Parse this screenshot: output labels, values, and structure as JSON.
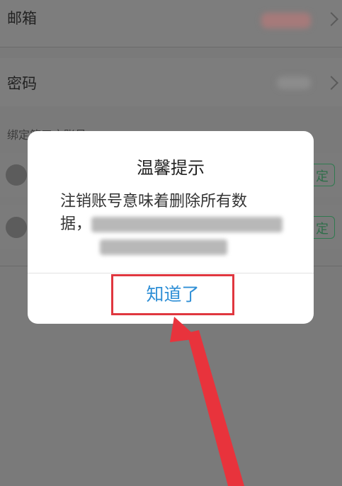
{
  "settings": {
    "email_label": "邮箱",
    "password_label": "密码",
    "third_party_section": "绑定第三方账号",
    "bind_button_label": "定"
  },
  "dialog": {
    "title": "温馨提示",
    "message_line1": "注销账号意味着删除所有数",
    "message_line2_start": "据，",
    "ok_button_label": "知道了"
  },
  "colors": {
    "ok_text": "#2f8fd6",
    "highlight_box": "#e0373f",
    "arrow": "#e8333c"
  }
}
